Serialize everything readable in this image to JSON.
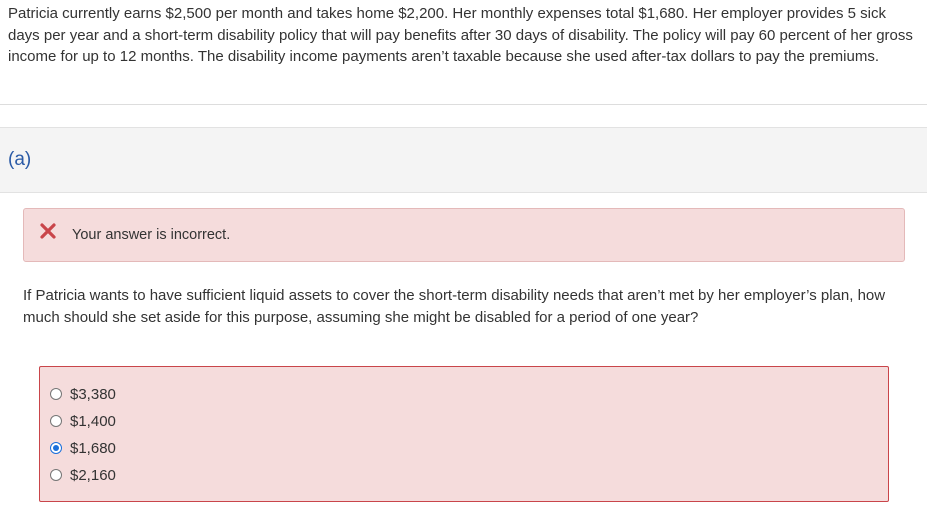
{
  "problem": {
    "text": "Patricia currently earns $2,500 per month and takes home $2,200. Her monthly expenses total $1,680. Her employer provides 5 sick days per year and a short-term disability policy that will pay benefits after 30 days of disability. The policy will pay 60 percent of her gross income for up to 12 months. The disability income payments aren’t taxable because she used after-tax dollars to pay the premiums."
  },
  "part": {
    "label": "(a)"
  },
  "alert": {
    "icon": "x-mark-icon",
    "text": "Your answer is incorrect.",
    "color": "#c9454a"
  },
  "question": {
    "text": "If Patricia wants to have sufficient liquid assets to cover the short-term disability needs that aren’t met by her employer’s plan, how much should she set aside for this purpose, assuming she might be disabled for a period of one year?"
  },
  "choices": {
    "options": [
      {
        "label": "$3,380",
        "selected": false
      },
      {
        "label": "$1,400",
        "selected": false
      },
      {
        "label": "$1,680",
        "selected": true
      },
      {
        "label": "$2,160",
        "selected": false
      }
    ],
    "selected_value": "$1,680"
  },
  "colors": {
    "accent": "#2a5aa6",
    "error_background": "#f5dcdc",
    "error_border": "#c9454a",
    "radio_checked": "#1a6fdb"
  }
}
